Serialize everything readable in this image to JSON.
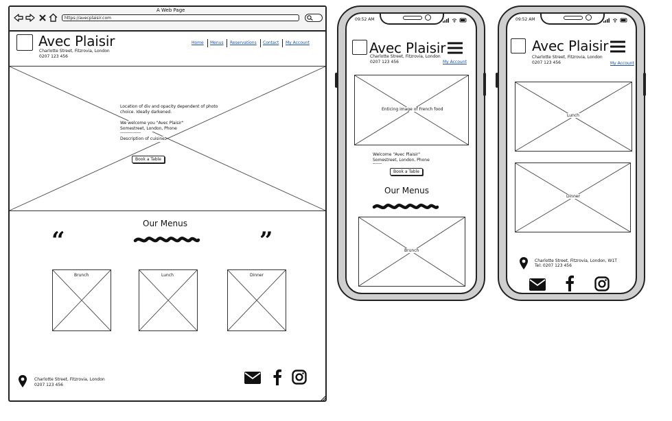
{
  "desktop": {
    "window_title": "A Web Page",
    "url": "https://avecplaisir.com",
    "brand": "Avec Plaisir",
    "address_line1": "Charlotte Street, Fitzrovia, London",
    "address_line2": "0207 123 456",
    "nav": [
      "Home",
      "Menus",
      "Reservations",
      "Contact",
      "My Account"
    ],
    "hero": {
      "line1": "Location of div and opacity dependent of photo",
      "line2": "choice. Ideally darkened.",
      "line3": "We welcome you \"Avec Plaisir\"",
      "line4": "Somestreet, London, Phone",
      "line5": "--------------",
      "line6": "Description of cuisine",
      "button": "Book a Table"
    },
    "menus_heading": "Our Menus",
    "menu_cards": [
      "Brunch",
      "Lunch",
      "Dinner"
    ],
    "footer_address_line1": "Charlotte Street, Fitzrovia, London",
    "footer_address_line2": "0207 123 456"
  },
  "phone1": {
    "time": "09:52 AM",
    "brand": "Avec Plaisir",
    "address_line1": "Charlotte Street, Fitzrovia, London",
    "address_line2": "0207 123 456",
    "account": "My Account",
    "image_label": "Enticing image of French food",
    "welcome_line1": "Welcome \"Avec Plaisir\"",
    "welcome_line2": "Somestreet, London, Phone",
    "welcome_line3": "------",
    "button": "Book a Table",
    "menus_heading": "Our Menus",
    "card": "Brunch"
  },
  "phone2": {
    "time": "09:52 AM",
    "brand": "Avec Plaisir",
    "address_line1": "Charlotte Street, Fitzrovia, London",
    "address_line2": "0207 123 456",
    "account": "My Account",
    "cards": [
      "Lunch",
      "Dinner"
    ],
    "footer_line1": "Charlotte Street, Fitzrovia, London, W1T",
    "footer_line2": "Tel: 0207 123 456"
  },
  "icons": [
    "back-icon",
    "forward-icon",
    "close-icon",
    "home-icon",
    "search-icon",
    "quote-open-icon",
    "quote-close-icon",
    "location-pin-icon",
    "email-icon",
    "facebook-icon",
    "instagram-icon",
    "hamburger-menu-icon",
    "signal-icon",
    "wifi-icon",
    "battery-icon",
    "resize-handle-icon"
  ]
}
